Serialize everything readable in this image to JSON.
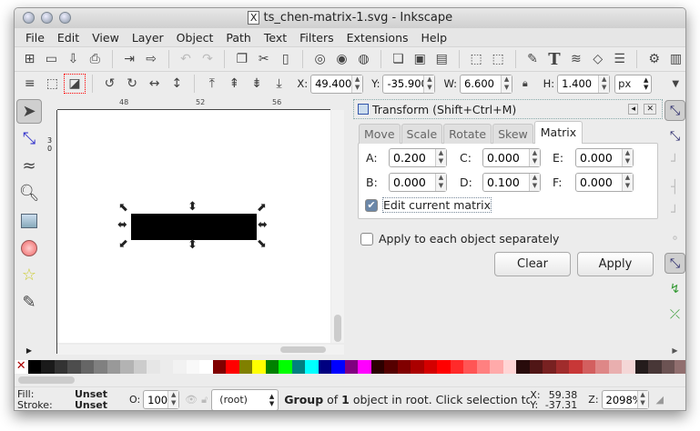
{
  "window": {
    "title": "ts_chen-matrix-1.svg - Inkscape"
  },
  "menu": [
    "File",
    "Edit",
    "View",
    "Layer",
    "Object",
    "Path",
    "Text",
    "Filters",
    "Extensions",
    "Help"
  ],
  "toolbar2": {
    "x_label": "X:",
    "x": "49.400",
    "y_label": "Y:",
    "y": "-35.900",
    "w_label": "W:",
    "w": "6.600",
    "h_label": "H:",
    "h": "1.400",
    "unit": "px"
  },
  "ruler": {
    "h_ticks": [
      "48",
      "52",
      "56"
    ],
    "v_ticks": [
      "3",
      "0"
    ]
  },
  "dialog": {
    "title": "Transform (Shift+Ctrl+M)",
    "tabs": [
      "Move",
      "Scale",
      "Rotate",
      "Skew",
      "Matrix"
    ],
    "active_tab": "Matrix",
    "fields": {
      "A": "0.200",
      "B": "0.000",
      "C": "0.000",
      "D": "0.100",
      "E": "0.000",
      "F": "0.000"
    },
    "labels": {
      "A": "A:",
      "B": "B:",
      "C": "C:",
      "D": "D:",
      "E": "E:",
      "F": "F:"
    },
    "edit_current": "Edit current matrix",
    "edit_current_checked": true,
    "apply_each": "Apply to each object separately",
    "apply_each_checked": false,
    "clear": "Clear",
    "apply": "Apply"
  },
  "palette": [
    "#000000",
    "#1a1a1a",
    "#333333",
    "#4d4d4d",
    "#666666",
    "#808080",
    "#999999",
    "#b3b3b3",
    "#cccccc",
    "#e6e6e6",
    "#ececec",
    "#f2f2f2",
    "#f9f9f9",
    "#ffffff",
    "#800000",
    "#ff0000",
    "#808000",
    "#ffff00",
    "#008000",
    "#00ff00",
    "#008080",
    "#00ffff",
    "#000080",
    "#0000ff",
    "#800080",
    "#ff00ff",
    "#2b0000",
    "#550000",
    "#800000",
    "#aa0000",
    "#d40000",
    "#ff0000",
    "#ff2a2a",
    "#ff5555",
    "#ff8080",
    "#ffaaaa",
    "#ffd5d5",
    "#280b0b",
    "#501616",
    "#782121",
    "#a02c2c",
    "#c83737",
    "#d35f5f",
    "#de8787",
    "#e9afaf",
    "#f4d7d7",
    "#241c1c",
    "#483737",
    "#6c5353",
    "#916f6f",
    "#ac9393",
    "#c8b7b7",
    "#e3dbdb",
    "#2b1100",
    "#552200"
  ],
  "status": {
    "fill_label": "Fill:",
    "fill": "Unset",
    "stroke_label": "Stroke:",
    "stroke": "Unset",
    "opacity_label": "O:",
    "opacity": "100",
    "layer": "(root)",
    "msg_bold1": "Group",
    "msg_t1": " of ",
    "msg_bold2": "1",
    "msg_t2": " object in root. Click selection to to",
    "cx_label": "X:",
    "cx": "59.38",
    "cy_label": "Y:",
    "cy": "-37.31",
    "zoom_label": "Z:",
    "zoom": "2098%"
  }
}
